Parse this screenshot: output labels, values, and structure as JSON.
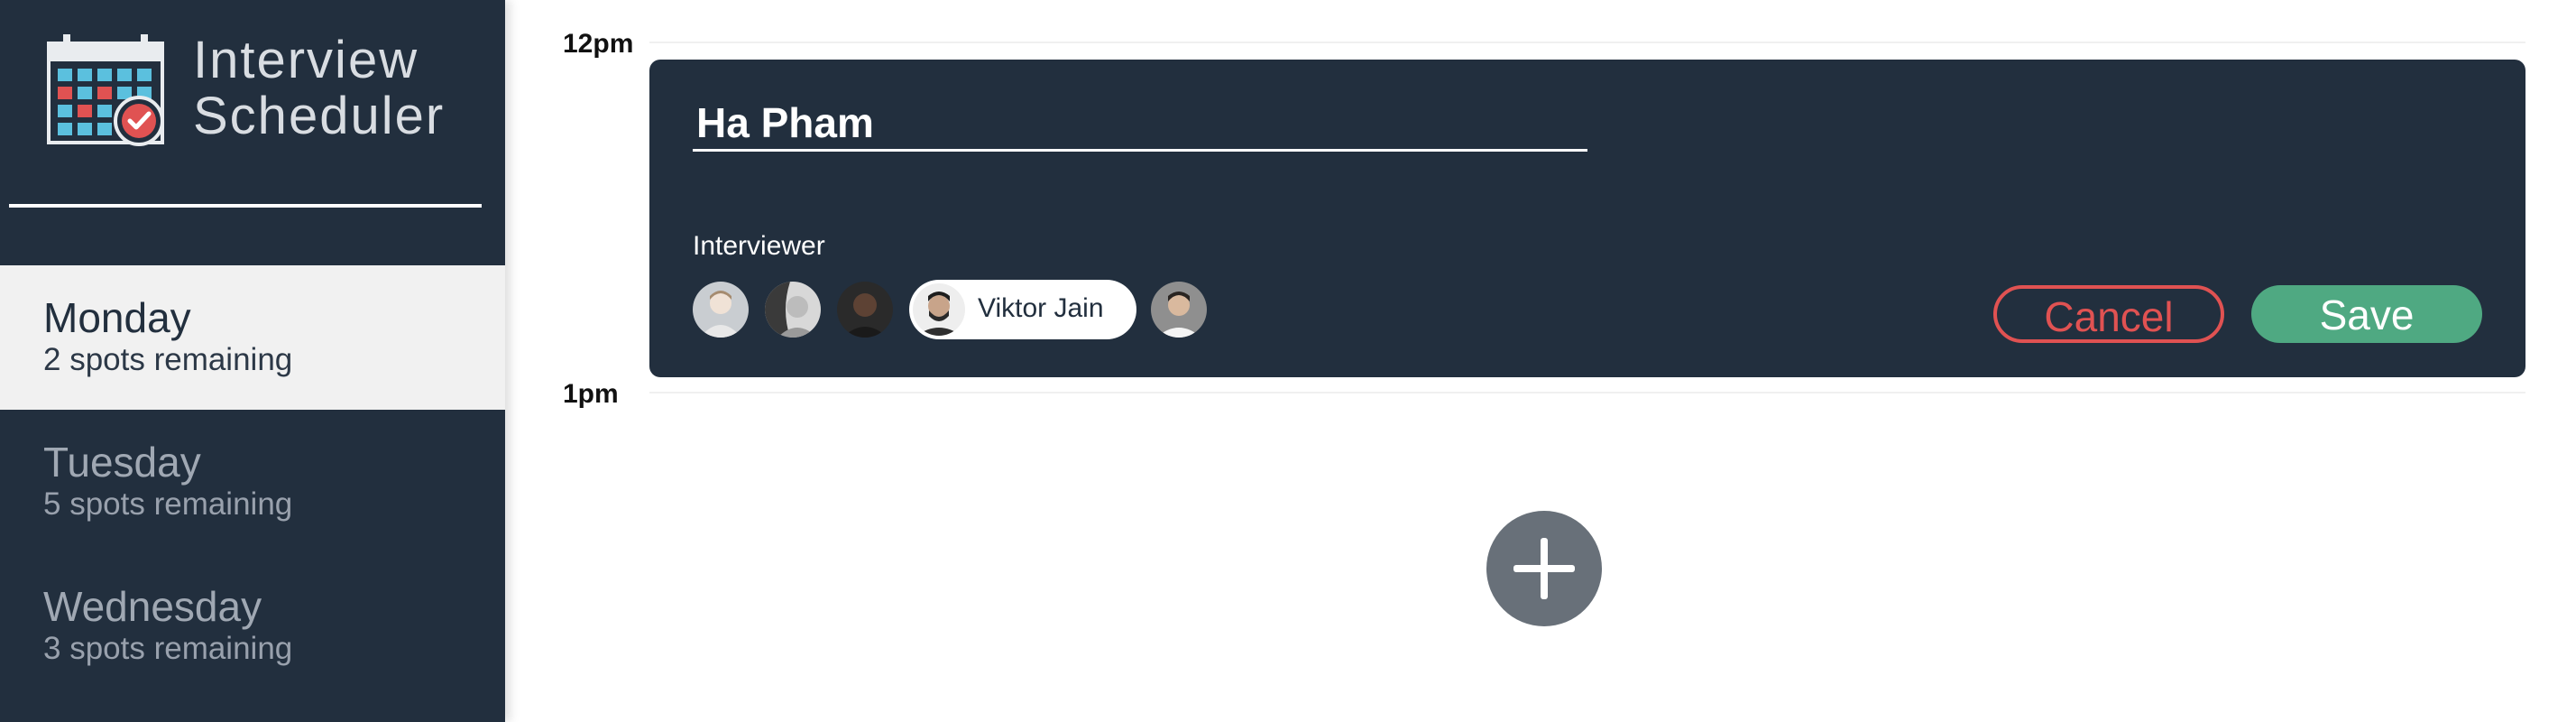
{
  "app": {
    "title_line1": "Interview",
    "title_line2": "Scheduler"
  },
  "days": [
    {
      "name": "Monday",
      "spots": "2 spots remaining",
      "selected": true
    },
    {
      "name": "Tuesday",
      "spots": "5 spots remaining",
      "selected": false
    },
    {
      "name": "Wednesday",
      "spots": "3 spots remaining",
      "selected": false
    }
  ],
  "schedule": {
    "time_12": "12pm",
    "time_1": "1pm"
  },
  "form": {
    "student_name": "Ha Pham",
    "interviewer_label": "Interviewer",
    "selected_interviewer": "Viktor Jain",
    "cancel_label": "Cancel",
    "save_label": "Save"
  },
  "colors": {
    "sidebar": "#222f3e",
    "card": "#222f3e",
    "cancel": "#e05252",
    "save": "#4fa982",
    "add_button": "#687079"
  },
  "icons": {
    "logo": "calendar-icon",
    "add": "plus-icon"
  }
}
